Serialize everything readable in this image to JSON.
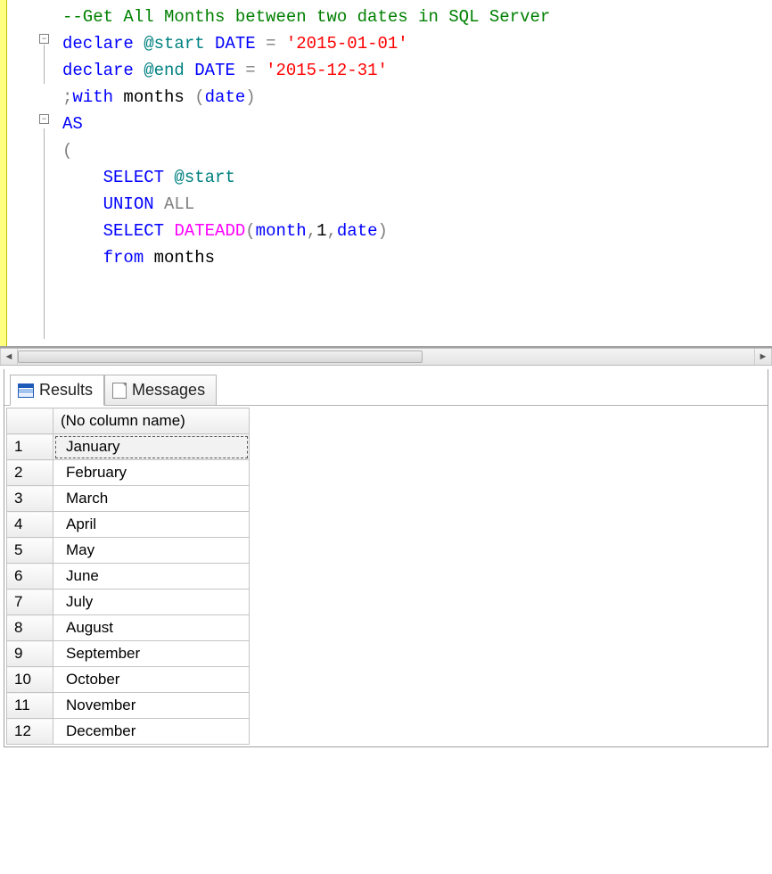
{
  "editor": {
    "tokens": [
      [
        {
          "t": "--Get All Months between two dates in SQL Server",
          "c": "tok-comment"
        }
      ],
      [
        {
          "t": "declare",
          "c": "tok-keyword"
        },
        {
          "t": " @start ",
          "c": "tok-teal"
        },
        {
          "t": "DATE",
          "c": "tok-keyword"
        },
        {
          "t": " ",
          "c": "tok-black"
        },
        {
          "t": "=",
          "c": "tok-gray"
        },
        {
          "t": " ",
          "c": "tok-black"
        },
        {
          "t": "'2015-01-01'",
          "c": "tok-string"
        }
      ],
      [
        {
          "t": "declare",
          "c": "tok-keyword"
        },
        {
          "t": " @end ",
          "c": "tok-teal"
        },
        {
          "t": "DATE",
          "c": "tok-keyword"
        },
        {
          "t": " ",
          "c": "tok-black"
        },
        {
          "t": "=",
          "c": "tok-gray"
        },
        {
          "t": " ",
          "c": "tok-black"
        },
        {
          "t": "'2015-12-31'",
          "c": "tok-string"
        }
      ],
      [
        {
          "t": "",
          "c": "tok-black"
        }
      ],
      [
        {
          "t": ";",
          "c": "tok-gray"
        },
        {
          "t": "with",
          "c": "tok-keyword"
        },
        {
          "t": " months ",
          "c": "tok-black"
        },
        {
          "t": "(",
          "c": "tok-gray"
        },
        {
          "t": "date",
          "c": "tok-keyword"
        },
        {
          "t": ")",
          "c": "tok-gray"
        }
      ],
      [
        {
          "t": "AS",
          "c": "tok-keyword"
        }
      ],
      [
        {
          "t": "(",
          "c": "tok-gray"
        }
      ],
      [
        {
          "t": "    ",
          "c": "tok-black"
        },
        {
          "t": "SELECT",
          "c": "tok-keyword"
        },
        {
          "t": " @start",
          "c": "tok-teal"
        }
      ],
      [
        {
          "t": "    ",
          "c": "tok-black"
        },
        {
          "t": "UNION",
          "c": "tok-keyword"
        },
        {
          "t": " ",
          "c": "tok-black"
        },
        {
          "t": "ALL",
          "c": "tok-gray"
        }
      ],
      [
        {
          "t": "    ",
          "c": "tok-black"
        },
        {
          "t": "SELECT",
          "c": "tok-keyword"
        },
        {
          "t": " ",
          "c": "tok-black"
        },
        {
          "t": "DATEADD",
          "c": "tok-builtin"
        },
        {
          "t": "(",
          "c": "tok-gray"
        },
        {
          "t": "month",
          "c": "tok-keyword"
        },
        {
          "t": ",",
          "c": "tok-gray"
        },
        {
          "t": "1",
          "c": "tok-black"
        },
        {
          "t": ",",
          "c": "tok-gray"
        },
        {
          "t": "date",
          "c": "tok-keyword"
        },
        {
          "t": ")",
          "c": "tok-gray"
        }
      ],
      [
        {
          "t": "    ",
          "c": "tok-black"
        },
        {
          "t": "from",
          "c": "tok-keyword"
        },
        {
          "t": " months",
          "c": "tok-black"
        }
      ]
    ],
    "folds": [
      {
        "row": 1,
        "glyph": "−"
      },
      {
        "row": 4,
        "glyph": "−"
      }
    ]
  },
  "tabs": {
    "results": "Results",
    "messages": "Messages"
  },
  "results": {
    "column": "(No column name)",
    "rows": [
      "January",
      "February",
      "March",
      "April",
      "May",
      "June",
      "July",
      "August",
      "September",
      "October",
      "November",
      "December"
    ],
    "selected_row_index": 0
  }
}
